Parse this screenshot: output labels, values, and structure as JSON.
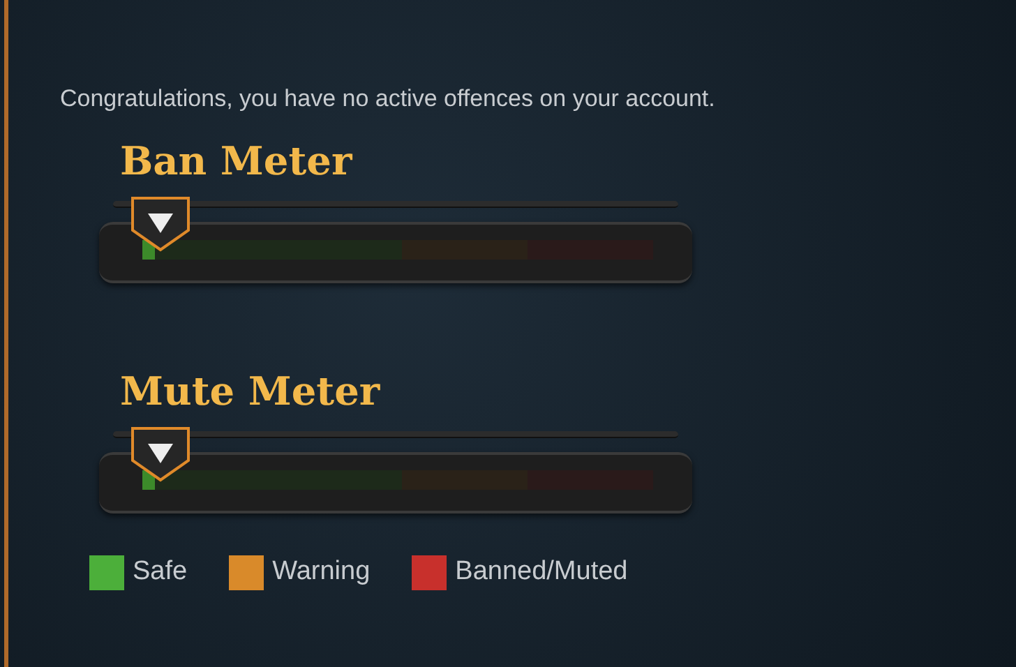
{
  "message": "Congratulations, you have no active offences on your account.",
  "meters": [
    {
      "title": "Ban Meter",
      "level": 0.025
    },
    {
      "title": "Mute Meter",
      "level": 0.025
    }
  ],
  "legend": [
    {
      "label": "Safe",
      "color": "#4caf3a"
    },
    {
      "label": "Warning",
      "color": "#d98a2a"
    },
    {
      "label": "Banned/Muted",
      "color": "#c8302c"
    }
  ]
}
